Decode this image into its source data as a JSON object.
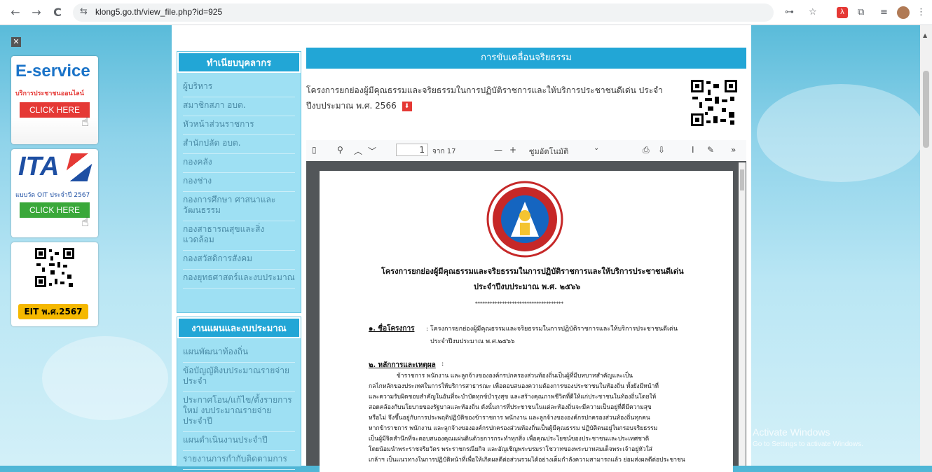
{
  "browser": {
    "url": "klong5.go.th/view_file.php?id=925",
    "back_icon": "←",
    "forward_icon": "→",
    "reload_icon": "C",
    "site_info_icon": "⇆"
  },
  "banners": {
    "eservice_title": "E-service",
    "eservice_sub": "บริการประชาชนออนไลน์",
    "eservice_btn": "CLICK HERE",
    "ita_title": "ITA",
    "ita_sub": "แบบวัด OIT ประจำปี 2567",
    "ita_btn": "CLICK HERE",
    "eit_label": "EIT พ.ศ.2567"
  },
  "sidebar": {
    "personnel_title": "ทำเนียบบุคลากร",
    "personnel_items": [
      "ผู้บริหาร",
      "สมาชิกสภา อบต.",
      "หัวหน้าส่วนราชการ",
      "สำนักปลัด อบต.",
      "กองคลัง",
      "กองช่าง",
      "กองการศึกษา ศาสนาและวัฒนธรรม",
      "กองสาธารณสุขและสิ่งแวดล้อม",
      "กองสวัสดิการสังคม",
      "กองยุทธศาสตร์และงบประมาณ"
    ],
    "plan_title": "งานแผนและงบประมาณ",
    "plan_items": [
      "แผนพัฒนาท้องถิ่น",
      "ข้อบัญญัติงบประมาณรายจ่ายประจำ",
      "ประกาศโอน/แก้ไข/ตั้งรายการใหม่ งบประมาณรายจ่ายประจำปี",
      "แผนดำเนินงานประจำปี",
      "รายงานการกำกับติดตามการ"
    ]
  },
  "main": {
    "header": "การขับเคลื่อนจริยธรรม",
    "title_line1": "โครงการยกย่องผู้มีคุณธรรมและจริยธรรมในการปฏิบัติราชการและให้บริการประชาชนดีเด่น ประจำ",
    "title_line2": "ปีงบประมาณ พ.ศ. 2566"
  },
  "pdf": {
    "page_current": "1",
    "page_total": "จาก 17",
    "zoom": "ซูมอัตโนมัติ",
    "doc_title1": "โครงการยกย่องผู้มีคุณธรรมและจริยธรรมในการปฏิบัติราชการและให้บริการประชาชนดีเด่น",
    "doc_title2": "ประจำปีงบประมาณ พ.ศ. ๒๕๖๖",
    "stars": "************************************",
    "sec1_label": "๑. ชื่อโครงการ",
    "sec1_text": ": โครงการยกย่องผู้มีคุณธรรมและจริยธรรมในการปฏิบัติราชการและให้บริการประชาชนดีเด่น",
    "sec1_text2": "ประจำปีงบประมาณ พ.ศ.๒๕๖๖",
    "sec2_label": "๒. หลักการและเหตุผล",
    "sec2_colon": ":",
    "body_lines": [
      "ข้าราชการ พนักงาน และลูกจ้างขององค์กรปกครองส่วนท้องถิ่นเป็นผู้ที่มีบทบาทสำคัญและเป็น",
      "กลไกหลักของประเทศในการให้บริการสาธารณะ เพื่อตอบสนองความต้องการของประชาชนในท้องถิ่น ทั้งยังมีหน้าที่",
      "และความรับผิดชอบสำคัญในอันที่จะบำบัดทุกข์บำรุงสุข และสร้างคุณภาพชีวิตที่ดีให้แก่ประชาชนในท้องถิ่นโดยให้",
      "สอดคล้องกับนโยบายของรัฐบาลและท้องถิ่น ดังนั้นการที่ประชาชนในแต่ละท้องถิ่นจะมีความเป็นอยู่ที่ดีมีความสุข",
      "หรือไม่ จึงขึ้นอยู่กับการประพฤติปฏิบัติของข้าราชการ พนักงาน และลูกจ้างขององค์กรปกครองส่วนท้องถิ่นทุกคน",
      "หากข้าราชการ พนักงาน และลูกจ้างขององค์กรปกครองส่วนท้องถิ่นเป็นผู้มีคุณธรรม ปฏิบัติตนอยู่ในกรอบจริยธรรม",
      "เป็นผู้มีจิตสำนึกที่จะตอบสนองคุณแผ่นดินด้วยการกระทำทุกสิ่ง เพื่อคุณประโยชน์ของประชาชนและประเทศชาติ",
      "โดยน้อมนำพระราชจริยวัตร พระราชกรณียกิจ และอัญเชิญพระบรมราโชวาทของพระบาทสมเด็จพระเจ้าอยู่หัวใส่",
      "เกล้าฯ เป็นแนวทางในการปฏิบัติหน้าที่เพื่อให้เกิดผลดีต่อส่วนรวมได้อย่างเต็มกำลังความสามารถแล้ว ย่อมส่งผลดีต่อประชาชน"
    ]
  },
  "watermark": {
    "line1": "Activate Windows",
    "line2": "Go to Settings to activate Windows."
  },
  "colors": {
    "accent": "#22a6d6",
    "side_bg": "#9ee0f3",
    "menu_text": "#4a8aa5"
  }
}
